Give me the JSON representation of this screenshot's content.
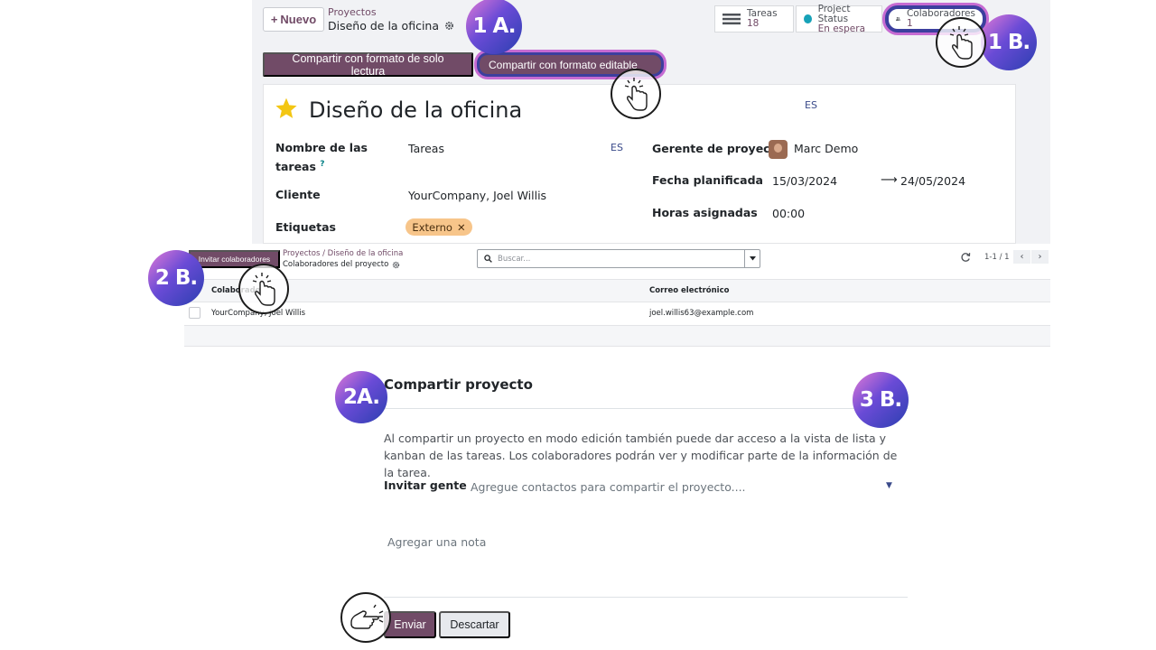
{
  "header": {
    "new_button": "Nuevo",
    "breadcrumb_parent": "Proyectos",
    "breadcrumb_current": "Diseño de la oficina",
    "stats": {
      "tasks_label": "Tareas",
      "tasks_value": "18",
      "status_label": "Project Status",
      "status_value": "En espera",
      "collaborators_label": "Colaboradores",
      "collaborators_value": "1"
    }
  },
  "share_buttons": {
    "readonly": "Compartir con formato de solo lectura",
    "editable": "Compartir con formato editable"
  },
  "form": {
    "title": "Diseño de la oficina",
    "lang_title": "ES",
    "task_name_label": "Nombre de las tareas",
    "task_name_value": "Tareas",
    "lang_task": "ES",
    "customer_label": "Cliente",
    "customer_value": "YourCompany, Joel Willis",
    "tags_label": "Etiquetas",
    "tag": "Externo",
    "pm_label": "Gerente de proyecto",
    "pm_value": "Marc Demo",
    "date_label": "Fecha planificada",
    "date_start": "15/03/2024",
    "date_end": "24/05/2024",
    "hours_label": "Horas asignadas",
    "hours_value": "00:00"
  },
  "collaborators_view": {
    "invite_button": "Invitar colaboradores",
    "breadcrumb_1": "Proyectos",
    "breadcrumb_2": "Diseño de la oficina",
    "breadcrumb_current": "Colaboradores del proyecto",
    "search_placeholder": "Buscar...",
    "pager": "1-1 / 1",
    "columns": [
      "Colaborador",
      "Correo electrónico"
    ],
    "rows": [
      {
        "name": "YourCompany, Joel Willis",
        "email": "joel.willis63@example.com"
      }
    ]
  },
  "wizard": {
    "title": "Compartir proyecto",
    "description": "Al compartir un proyecto en modo edición también puede dar acceso a la vista de lista y kanban de las tareas. Los colaboradores podrán ver y modificar parte de la información de la tarea.",
    "invite_label": "Invitar gente",
    "invite_placeholder": "Agregue contactos para compartir el proyecto....",
    "note_placeholder": "Agregar una nota",
    "send_button": "Enviar",
    "discard_button": "Descartar"
  },
  "badges": {
    "step_1a": "1 A.",
    "step_1b": "1 B.",
    "step_2a": "2A.",
    "step_2b": "2 B.",
    "step_3b": "3 B."
  },
  "colors": {
    "primary": "#714b67",
    "badge_gradient_start": "#e27ad6",
    "badge_gradient_end": "#2b3fb0",
    "tag": "#f7c58a",
    "status_dot": "#17a2b8"
  }
}
